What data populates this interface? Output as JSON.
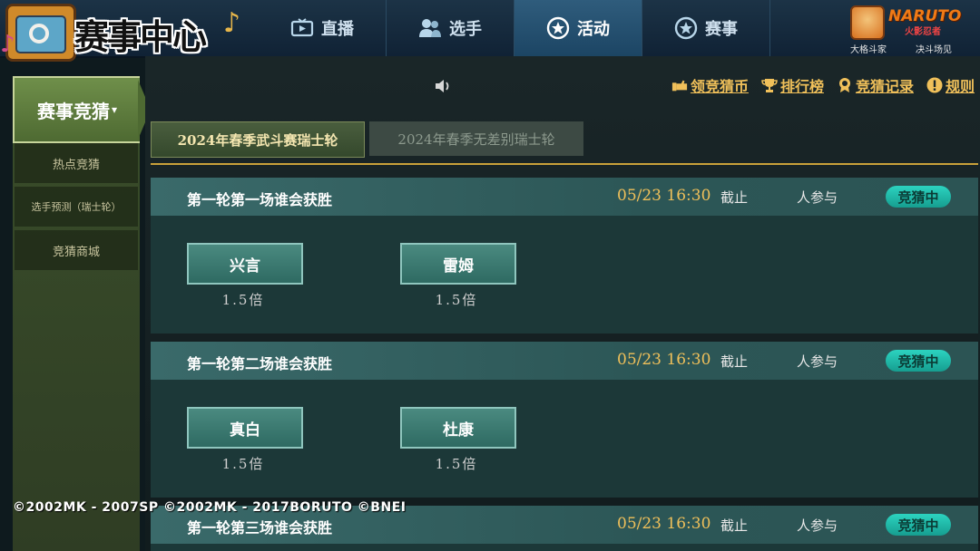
{
  "logo": {
    "title": "赛事中心"
  },
  "nav": {
    "tabs": [
      {
        "label": "直播",
        "icon": "tv-icon"
      },
      {
        "label": "选手",
        "icon": "users-icon"
      },
      {
        "label": "活动",
        "icon": "star-icon",
        "active": true
      },
      {
        "label": "赛事",
        "icon": "star-icon"
      }
    ]
  },
  "brand": {
    "name": "NARUTO",
    "sub": "火影忍者",
    "tag1": "大格斗家",
    "tag2": "决斗场见"
  },
  "sidebar": {
    "header": "赛事竞猜",
    "items": [
      "热点竞猜",
      "选手预测（瑞士轮）",
      "竞猜商城"
    ]
  },
  "links": {
    "claim": "领竞猜币",
    "ranking": "排行榜",
    "record": "竞猜记录",
    "rules": "规则"
  },
  "subtabs": {
    "active": "2024年春季武斗赛瑞士轮",
    "inactive": "2024年春季无差别瑞士轮"
  },
  "matches": [
    {
      "title": "第一轮第一场谁会获胜",
      "date": "05/23 16:30",
      "cutoff": "截止",
      "count": "人参与",
      "status": "竞猜中",
      "left": {
        "name": "兴言",
        "odds": "1.5倍"
      },
      "right": {
        "name": "雷姆",
        "odds": "1.5倍"
      }
    },
    {
      "title": "第一轮第二场谁会获胜",
      "date": "05/23 16:30",
      "cutoff": "截止",
      "count": "人参与",
      "status": "竞猜中",
      "left": {
        "name": "真白",
        "odds": "1.5倍"
      },
      "right": {
        "name": "杜康",
        "odds": "1.5倍"
      }
    },
    {
      "title": "第一轮第三场谁会获胜",
      "date": "05/23 16:30",
      "cutoff": "截止",
      "count": "人参与",
      "status": "竞猜中"
    }
  ],
  "copyright": "©2002MK - 2007SP ©2002MK - 2017BORUTO ©BNEI",
  "colors": {
    "gold": "#f0c05a",
    "badge": "#2cd3c0",
    "activeTab": "#2f5c7c"
  }
}
